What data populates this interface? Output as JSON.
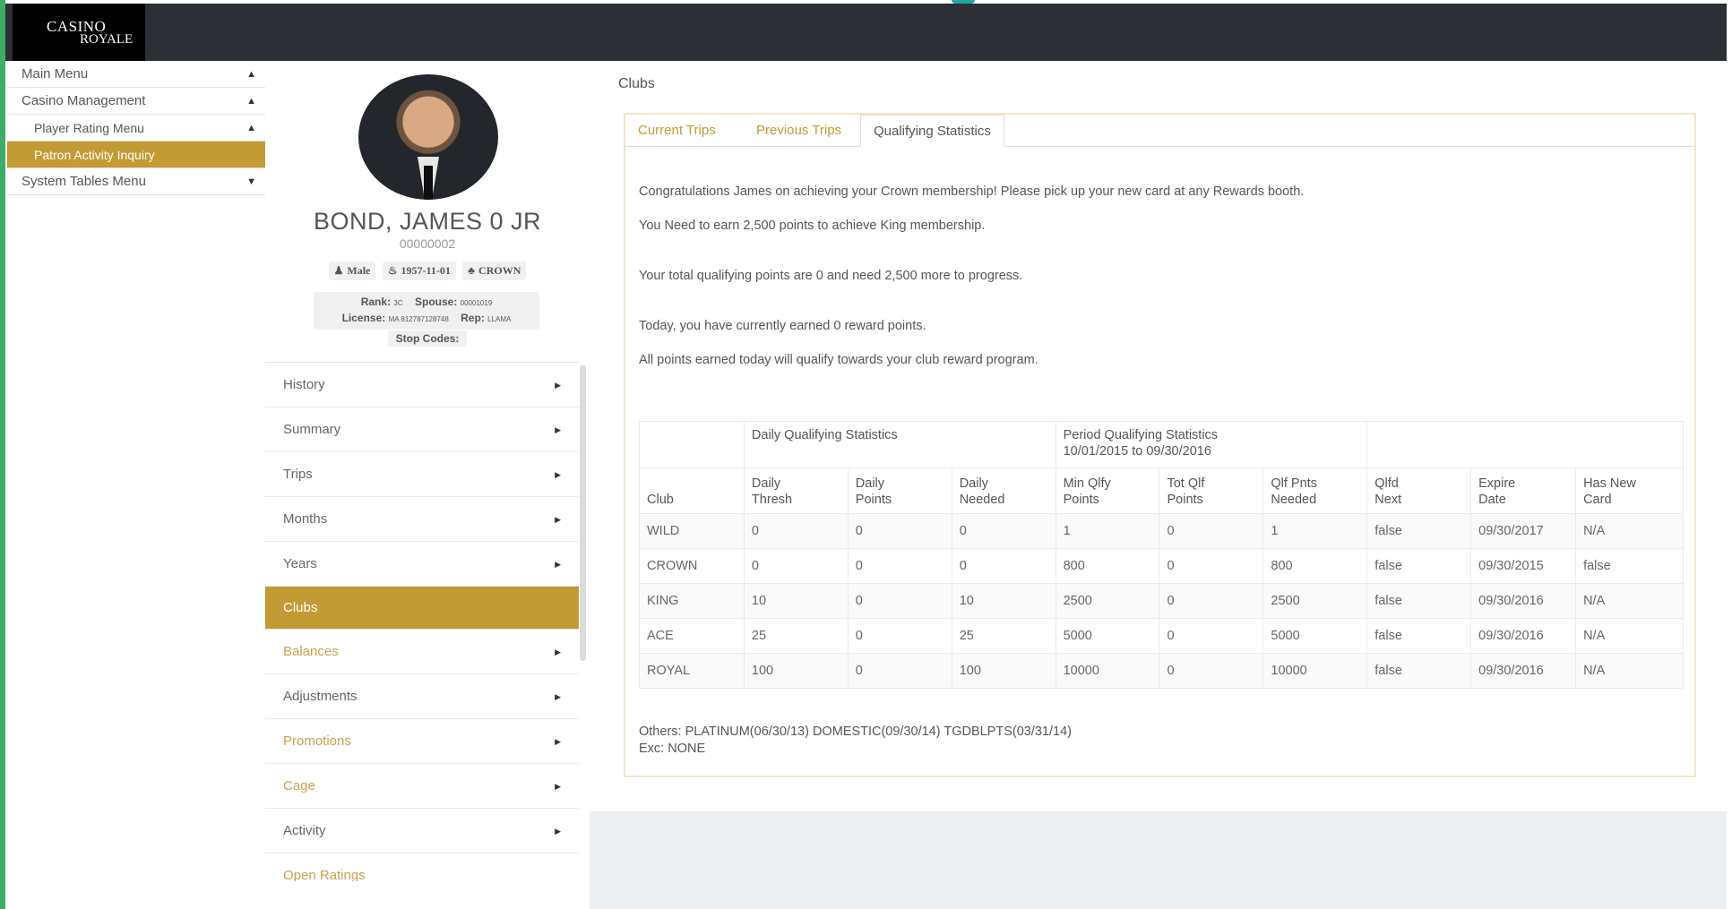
{
  "brand": {
    "logo_line1": "CASINO",
    "logo_line2": "ROYALE"
  },
  "left_menu": [
    {
      "label": "Main Menu",
      "caret": "▲"
    },
    {
      "label": "Casino Management",
      "caret": "▲"
    },
    {
      "label": "Player Rating Menu",
      "caret": "▲"
    },
    {
      "label": "Patron Activity Inquiry",
      "caret": ""
    },
    {
      "label": "System Tables Menu",
      "caret": "▼"
    }
  ],
  "patron": {
    "name": "BOND, JAMES 0 JR",
    "id": "00000002",
    "gender": "Male",
    "dob": "1957-11-01",
    "tier": "CROWN",
    "rank_label": "Rank:",
    "rank": "3C",
    "spouse_label": "Spouse:",
    "spouse": "00001019",
    "license_label": "License:",
    "license": "MA 812787128748",
    "rep_label": "Rep:",
    "rep": "LLAMA",
    "stop_codes": "Stop Codes:"
  },
  "sub_menu": [
    "History",
    "Summary",
    "Trips",
    "Months",
    "Years",
    "Clubs",
    "Balances",
    "Adjustments",
    "Promotions",
    "Cage",
    "Activity",
    "Open Ratings"
  ],
  "content": {
    "title": "Clubs",
    "tabs": [
      "Current Trips",
      "Previous Trips",
      "Qualifying Statistics"
    ],
    "messages": [
      "Congratulations James on achieving your Crown membership! Please pick up your new card at any Rewards booth.",
      "You Need to earn 2,500 points to achieve King membership.",
      "Your total qualifying points are 0 and need 2,500 more to progress.",
      "Today, you have currently earned 0 reward points.",
      "All points earned today will qualify towards your club reward program."
    ],
    "table": {
      "group_daily": "Daily Qualifying Statistics",
      "group_period": "Period Qualifying Statistics",
      "group_period_range": "10/01/2015 to 09/30/2016",
      "columns": [
        [
          "",
          "Club"
        ],
        [
          "Daily",
          "Thresh"
        ],
        [
          "Daily",
          "Points"
        ],
        [
          "Daily",
          "Needed"
        ],
        [
          "Min Qlfy",
          "Points"
        ],
        [
          "Tot Qlf",
          "Points"
        ],
        [
          "Qlf Pnts",
          "Needed"
        ],
        [
          "Qlfd",
          "Next"
        ],
        [
          "Expire",
          "Date"
        ],
        [
          "Has New",
          "Card"
        ]
      ],
      "rows": [
        [
          "WILD",
          "0",
          "0",
          "0",
          "1",
          "0",
          "1",
          "false",
          "09/30/2017",
          "N/A"
        ],
        [
          "CROWN",
          "0",
          "0",
          "0",
          "800",
          "0",
          "800",
          "false",
          "09/30/2015",
          "false"
        ],
        [
          "KING",
          "10",
          "0",
          "10",
          "2500",
          "0",
          "2500",
          "false",
          "09/30/2016",
          "N/A"
        ],
        [
          "ACE",
          "25",
          "0",
          "25",
          "5000",
          "0",
          "5000",
          "false",
          "09/30/2016",
          "N/A"
        ],
        [
          "ROYAL",
          "100",
          "0",
          "100",
          "10000",
          "0",
          "10000",
          "false",
          "09/30/2016",
          "N/A"
        ]
      ]
    },
    "others": "Others: PLATINUM(06/30/13) DOMESTIC(09/30/14) TGDBLPTS(03/31/14)",
    "exc": "Exc: NONE"
  },
  "colors": {
    "topbar": "#2c2f35",
    "accent_gold": "#c39b34",
    "left_stripe": "#3cae6a"
  }
}
